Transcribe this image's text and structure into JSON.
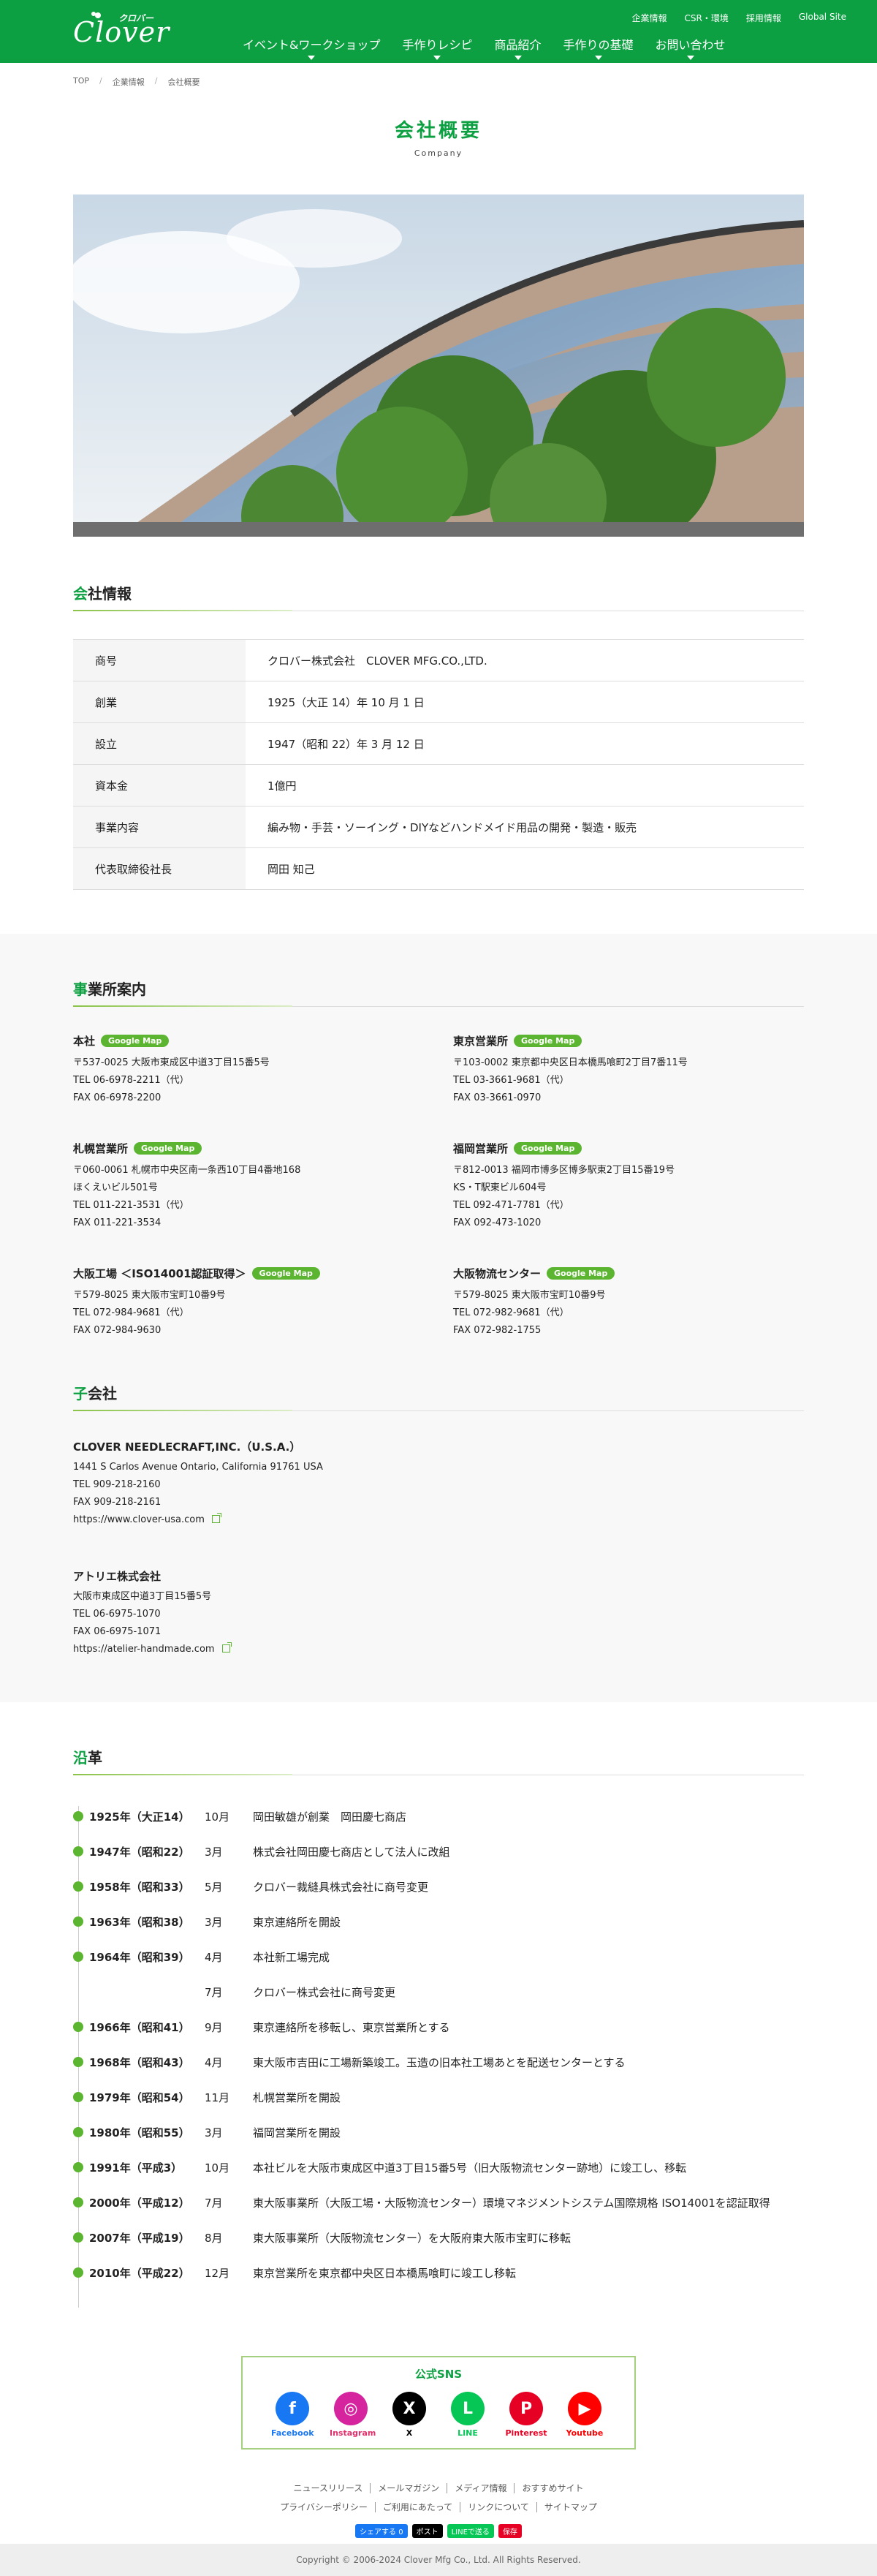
{
  "header": {
    "logo_text": "Clover",
    "logo_kana": "クロバー",
    "util_nav": [
      "企業情報",
      "CSR・環境",
      "採用情報",
      "Global Site"
    ],
    "main_nav": [
      "イベント&ワークショップ",
      "手作りレシピ",
      "商品紹介",
      "手作りの基礎",
      "お問い合わせ"
    ]
  },
  "breadcrumb": [
    "TOP",
    "企業情報",
    "会社概要"
  ],
  "page_title": {
    "ja": "会社概要",
    "en": "Company"
  },
  "company_info": {
    "heading_first": "会",
    "heading_rest": "社情報",
    "rows": [
      {
        "label": "商号",
        "value": "クロバー株式会社　CLOVER MFG.CO.,LTD."
      },
      {
        "label": "創業",
        "value": "1925（大正 14）年 10 月 1 日"
      },
      {
        "label": "設立",
        "value": "1947（昭和 22）年 3 月 12 日"
      },
      {
        "label": "資本金",
        "value": "1億円"
      },
      {
        "label": "事業内容",
        "value": "編み物・手芸・ソーイング・DIYなどハンドメイド用品の開発・製造・販売"
      },
      {
        "label": "代表取締役社長",
        "value": "岡田 知己"
      }
    ]
  },
  "offices": {
    "heading_first": "事",
    "heading_rest": "業所案内",
    "gmap_label": "Google Map",
    "items": [
      {
        "name": "本社",
        "lines": [
          "〒537-0025 大阪市東成区中道3丁目15番5号",
          "TEL 06-6978-2211（代）",
          "FAX 06-6978-2200"
        ]
      },
      {
        "name": "東京営業所",
        "lines": [
          "〒103-0002 東京都中央区日本橋馬喰町2丁目7番11号",
          "TEL 03-3661-9681（代）",
          "FAX 03-3661-0970"
        ]
      },
      {
        "name": "札幌営業所",
        "lines": [
          "〒060-0061 札幌市中央区南一条西10丁目4番地168",
          "ほくえいビル501号",
          "TEL 011-221-3531（代）",
          "FAX 011-221-3534"
        ]
      },
      {
        "name": "福岡営業所",
        "lines": [
          "〒812-0013 福岡市博多区博多駅東2丁目15番19号",
          "KS・T駅東ビル604号",
          "TEL 092-471-7781（代）",
          "FAX 092-473-1020"
        ]
      },
      {
        "name": "大阪工場 ＜ISO14001認証取得＞",
        "lines": [
          "〒579-8025 東大阪市宝町10番9号",
          "TEL 072-984-9681（代）",
          "FAX 072-984-9630"
        ]
      },
      {
        "name": "大阪物流センター",
        "lines": [
          "〒579-8025 東大阪市宝町10番9号",
          "TEL 072-982-9681（代）",
          "FAX 072-982-1755"
        ]
      }
    ]
  },
  "subsidiaries": {
    "heading_first": "子",
    "heading_rest": "会社",
    "items": [
      {
        "name": "CLOVER NEEDLECRAFT,INC.（U.S.A.）",
        "lines": [
          "1441 S Carlos Avenue Ontario, California 91761 USA",
          "TEL 909-218-2160",
          "FAX 909-218-2161"
        ],
        "url": "https://www.clover-usa.com"
      },
      {
        "name": "アトリエ株式会社",
        "lines": [
          "大阪市東成区中道3丁目15番5号",
          "TEL 06-6975-1070",
          "FAX 06-6975-1071"
        ],
        "url": "https://atelier-handmade.com"
      }
    ]
  },
  "history": {
    "heading_first": "沿",
    "heading_rest": "革",
    "rows": [
      {
        "year": "1925年（大正14）",
        "month": "10月",
        "text": "岡田敏雄が創業　岡田慶七商店"
      },
      {
        "year": "1947年（昭和22）",
        "month": "3月",
        "text": "株式会社岡田慶七商店として法人に改組"
      },
      {
        "year": "1958年（昭和33）",
        "month": "5月",
        "text": "クロバー裁縫具株式会社に商号変更"
      },
      {
        "year": "1963年（昭和38）",
        "month": "3月",
        "text": "東京連絡所を開設"
      },
      {
        "year": "1964年（昭和39）",
        "month": "4月",
        "text": "本社新工場完成"
      },
      {
        "year": "",
        "month": "7月",
        "text": "クロバー株式会社に商号変更"
      },
      {
        "year": "1966年（昭和41）",
        "month": "9月",
        "text": "東京連絡所を移転し、東京営業所とする"
      },
      {
        "year": "1968年（昭和43）",
        "month": "4月",
        "text": "東大阪市吉田に工場新築竣工。玉造の旧本社工場あとを配送センターとする"
      },
      {
        "year": "1979年（昭和54）",
        "month": "11月",
        "text": "札幌営業所を開設"
      },
      {
        "year": "1980年（昭和55）",
        "month": "3月",
        "text": "福岡営業所を開設"
      },
      {
        "year": "1991年（平成3）",
        "month": "10月",
        "text": "本社ビルを大阪市東成区中道3丁目15番5号（旧大阪物流センター跡地）に竣工し、移転"
      },
      {
        "year": "2000年（平成12）",
        "month": "7月",
        "text": "東大阪事業所（大阪工場・大阪物流センター）環境マネジメントシステム国際規格 ISO14001を認証取得"
      },
      {
        "year": "2007年（平成19）",
        "month": "8月",
        "text": "東大阪事業所（大阪物流センター）を大阪府東大阪市宝町に移転"
      },
      {
        "year": "2010年（平成22）",
        "month": "12月",
        "text": "東京営業所を東京都中央区日本橋馬喰町に竣工し移転"
      }
    ]
  },
  "sns": {
    "title": "公式SNS",
    "items": [
      {
        "label": "Facebook",
        "glyph": "f",
        "color": "#1877f2",
        "label_color": "#1877f2",
        "icon": "facebook-icon"
      },
      {
        "label": "Instagram",
        "glyph": "◎",
        "color": "#d6249f",
        "label_color": "#e1306c",
        "icon": "instagram-icon"
      },
      {
        "label": "X",
        "glyph": "X",
        "color": "#000000",
        "label_color": "#000000",
        "icon": "x-icon"
      },
      {
        "label": "LINE",
        "glyph": "L",
        "color": "#06c755",
        "label_color": "#06c755",
        "icon": "line-icon"
      },
      {
        "label": "Pinterest",
        "glyph": "P",
        "color": "#e60023",
        "label_color": "#e60023",
        "icon": "pinterest-icon"
      },
      {
        "label": "Youtube",
        "glyph": "▶",
        "color": "#ff0000",
        "label_color": "#ff0000",
        "icon": "youtube-icon"
      }
    ]
  },
  "footer": {
    "links_row1": [
      "ニュースリリース",
      "メールマガジン",
      "メディア情報",
      "おすすめサイト"
    ],
    "links_row2": [
      "プライバシーポリシー",
      "ご利用にあたって",
      "リンクについて",
      "サイトマップ"
    ],
    "share": [
      {
        "label": "シェアする 0",
        "color": "#1877f2"
      },
      {
        "label": "ポスト",
        "color": "#000000"
      },
      {
        "label": "LINEで送る",
        "color": "#06c755"
      },
      {
        "label": "保存",
        "color": "#e60023"
      }
    ],
    "copyright": "Copyright © 2006-2024 Clover Mfg Co., Ltd. All Rights Reserved."
  }
}
